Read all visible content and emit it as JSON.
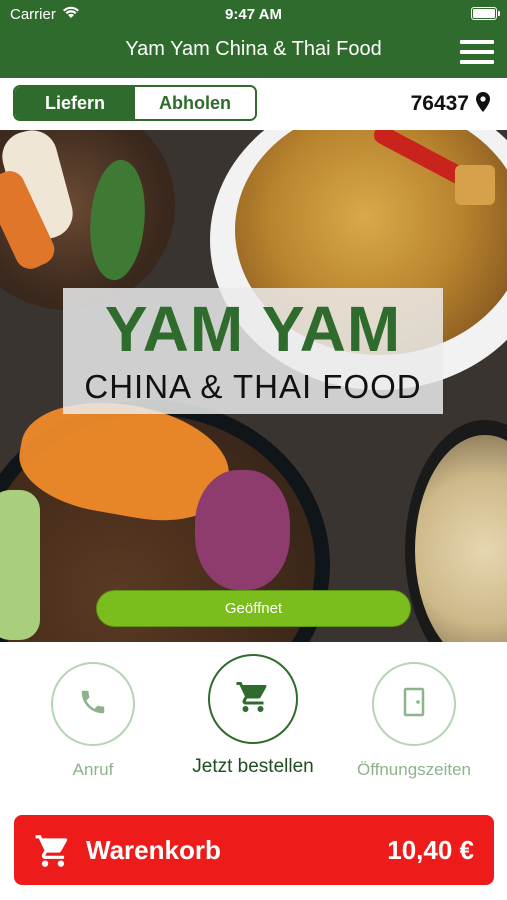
{
  "status_bar": {
    "carrier": "Carrier",
    "time": "9:47 AM"
  },
  "header": {
    "title": "Yam Yam China & Thai Food"
  },
  "delivery_toggle": {
    "options": [
      "Liefern",
      "Abholen"
    ],
    "selected": "Liefern"
  },
  "location": {
    "zip": "76437"
  },
  "hero": {
    "logo_line1": "YAM YAM",
    "logo_line2": "CHINA & THAI FOOD",
    "status_label": "Geöffnet"
  },
  "actions": [
    {
      "label": "Anruf",
      "icon": "phone-icon"
    },
    {
      "label": "Jetzt bestellen",
      "icon": "cart-icon"
    },
    {
      "label": "Öffnungszeiten",
      "icon": "door-icon"
    }
  ],
  "cart_bar": {
    "label": "Warenkorb",
    "total": "10,40 €"
  },
  "colors": {
    "brand_green": "#2e6b2c",
    "open_green": "#7cbd1e",
    "cart_red": "#ee1b1b"
  }
}
